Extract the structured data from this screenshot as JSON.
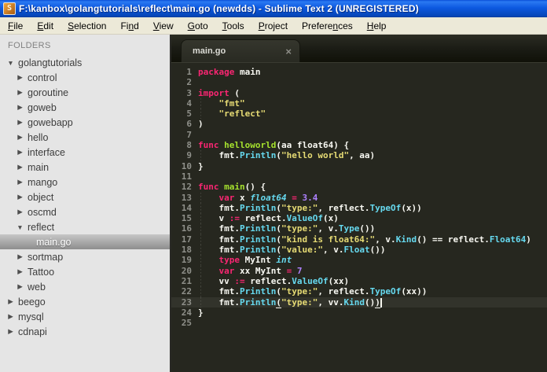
{
  "window": {
    "title": "F:\\kanbox\\golangtutorials\\reflect\\main.go (newdds) - Sublime Text 2 (UNREGISTERED)",
    "icon_letter": "S"
  },
  "menu": {
    "items": [
      {
        "label": "File",
        "u": 0
      },
      {
        "label": "Edit",
        "u": 0
      },
      {
        "label": "Selection",
        "u": 0
      },
      {
        "label": "Find",
        "u": 2
      },
      {
        "label": "View",
        "u": 0
      },
      {
        "label": "Goto",
        "u": 0
      },
      {
        "label": "Tools",
        "u": 0
      },
      {
        "label": "Project",
        "u": 0
      },
      {
        "label": "Preferences",
        "u": 7
      },
      {
        "label": "Help",
        "u": 0
      }
    ]
  },
  "sidebar": {
    "header": "FOLDERS",
    "icons": {
      "open": "▼",
      "closed": "▶"
    },
    "items": [
      {
        "label": "golangtutorials",
        "depth": 0,
        "state": "open"
      },
      {
        "label": "control",
        "depth": 1,
        "state": "closed"
      },
      {
        "label": "goroutine",
        "depth": 1,
        "state": "closed"
      },
      {
        "label": "goweb",
        "depth": 1,
        "state": "closed"
      },
      {
        "label": "gowebapp",
        "depth": 1,
        "state": "closed"
      },
      {
        "label": "hello",
        "depth": 1,
        "state": "closed"
      },
      {
        "label": "interface",
        "depth": 1,
        "state": "closed"
      },
      {
        "label": "main",
        "depth": 1,
        "state": "closed"
      },
      {
        "label": "mango",
        "depth": 1,
        "state": "closed"
      },
      {
        "label": "object",
        "depth": 1,
        "state": "closed"
      },
      {
        "label": "oscmd",
        "depth": 1,
        "state": "closed"
      },
      {
        "label": "reflect",
        "depth": 1,
        "state": "open"
      },
      {
        "label": "main.go",
        "depth": 2,
        "state": "file",
        "selected": true
      },
      {
        "label": "sortmap",
        "depth": 1,
        "state": "closed"
      },
      {
        "label": "Tattoo",
        "depth": 1,
        "state": "closed"
      },
      {
        "label": "web",
        "depth": 1,
        "state": "closed"
      },
      {
        "label": "beego",
        "depth": 0,
        "state": "closed"
      },
      {
        "label": "mysql",
        "depth": 0,
        "state": "closed"
      },
      {
        "label": "cdnapi",
        "depth": 0,
        "state": "closed"
      }
    ]
  },
  "tabbar": {
    "tabs": [
      {
        "label": "main.go",
        "close_glyph": "×",
        "active": true
      }
    ]
  },
  "editor": {
    "language": "Go",
    "current_line": 23,
    "colors": {
      "background": "#26271f",
      "keyword": "#f92672",
      "function": "#a6e22e",
      "string": "#e6db74",
      "type": "#66d9ef",
      "number": "#ae81ff",
      "plain": "#f8f8f2",
      "line_number": "#8f908a",
      "current_line_bg": "#32332b"
    },
    "lines": [
      {
        "num": 1,
        "tokens": [
          [
            "kw",
            "package"
          ],
          [
            "pl",
            " main"
          ]
        ]
      },
      {
        "num": 2,
        "tokens": []
      },
      {
        "num": 3,
        "tokens": [
          [
            "kw",
            "import"
          ],
          [
            "pl",
            " ("
          ]
        ]
      },
      {
        "num": 4,
        "tokens": [
          [
            "pl",
            "    "
          ],
          [
            "str",
            "\"fmt\""
          ]
        ]
      },
      {
        "num": 5,
        "tokens": [
          [
            "pl",
            "    "
          ],
          [
            "str",
            "\"reflect\""
          ]
        ]
      },
      {
        "num": 6,
        "tokens": [
          [
            "pl",
            ")"
          ]
        ]
      },
      {
        "num": 7,
        "tokens": []
      },
      {
        "num": 8,
        "tokens": [
          [
            "kw",
            "func"
          ],
          [
            "pl",
            " "
          ],
          [
            "fn",
            "helloworld"
          ],
          [
            "pl",
            "(aa float64) {"
          ]
        ]
      },
      {
        "num": 9,
        "tokens": [
          [
            "pl",
            "    fmt."
          ],
          [
            "typc",
            "Println"
          ],
          [
            "pl",
            "("
          ],
          [
            "str",
            "\"hello world\""
          ],
          [
            "pl",
            ", aa)"
          ]
        ]
      },
      {
        "num": 10,
        "tokens": [
          [
            "pl",
            "}"
          ]
        ]
      },
      {
        "num": 11,
        "tokens": []
      },
      {
        "num": 12,
        "tokens": [
          [
            "kw",
            "func"
          ],
          [
            "pl",
            " "
          ],
          [
            "fn",
            "main"
          ],
          [
            "pl",
            "() {"
          ]
        ]
      },
      {
        "num": 13,
        "tokens": [
          [
            "pl",
            "    "
          ],
          [
            "kw",
            "var"
          ],
          [
            "pl",
            " x "
          ],
          [
            "typ",
            "float64"
          ],
          [
            "pl",
            " "
          ],
          [
            "op",
            "="
          ],
          [
            "pl",
            " "
          ],
          [
            "num",
            "3.4"
          ]
        ]
      },
      {
        "num": 14,
        "tokens": [
          [
            "pl",
            "    fmt."
          ],
          [
            "typc",
            "Println"
          ],
          [
            "pl",
            "("
          ],
          [
            "str",
            "\"type:\""
          ],
          [
            "pl",
            ", reflect."
          ],
          [
            "typc",
            "TypeOf"
          ],
          [
            "pl",
            "(x))"
          ]
        ]
      },
      {
        "num": 15,
        "tokens": [
          [
            "pl",
            "    v "
          ],
          [
            "op",
            ":="
          ],
          [
            "pl",
            " reflect."
          ],
          [
            "typc",
            "ValueOf"
          ],
          [
            "pl",
            "(x)"
          ]
        ]
      },
      {
        "num": 16,
        "tokens": [
          [
            "pl",
            "    fmt."
          ],
          [
            "typc",
            "Println"
          ],
          [
            "pl",
            "("
          ],
          [
            "str",
            "\"type:\""
          ],
          [
            "pl",
            ", v."
          ],
          [
            "typc",
            "Type"
          ],
          [
            "pl",
            "())"
          ]
        ]
      },
      {
        "num": 17,
        "tokens": [
          [
            "pl",
            "    fmt."
          ],
          [
            "typc",
            "Println"
          ],
          [
            "pl",
            "("
          ],
          [
            "str",
            "\"kind is float64:\""
          ],
          [
            "pl",
            ", v."
          ],
          [
            "typc",
            "Kind"
          ],
          [
            "pl",
            "() == reflect."
          ],
          [
            "typc",
            "Float64"
          ],
          [
            "pl",
            ")"
          ]
        ]
      },
      {
        "num": 18,
        "tokens": [
          [
            "pl",
            "    fmt."
          ],
          [
            "typc",
            "Println"
          ],
          [
            "pl",
            "("
          ],
          [
            "str",
            "\"value:\""
          ],
          [
            "pl",
            ", v."
          ],
          [
            "typc",
            "Float"
          ],
          [
            "pl",
            "())"
          ]
        ]
      },
      {
        "num": 19,
        "tokens": [
          [
            "pl",
            "    "
          ],
          [
            "kw",
            "type"
          ],
          [
            "pl",
            " MyInt "
          ],
          [
            "typ",
            "int"
          ]
        ]
      },
      {
        "num": 20,
        "tokens": [
          [
            "pl",
            "    "
          ],
          [
            "kw",
            "var"
          ],
          [
            "pl",
            " xx MyInt "
          ],
          [
            "op",
            "="
          ],
          [
            "pl",
            " "
          ],
          [
            "num",
            "7"
          ]
        ]
      },
      {
        "num": 21,
        "tokens": [
          [
            "pl",
            "    vv "
          ],
          [
            "op",
            ":="
          ],
          [
            "pl",
            " reflect."
          ],
          [
            "typc",
            "ValueOf"
          ],
          [
            "pl",
            "(xx)"
          ]
        ]
      },
      {
        "num": 22,
        "tokens": [
          [
            "pl",
            "    fmt."
          ],
          [
            "typc",
            "Println"
          ],
          [
            "pl",
            "("
          ],
          [
            "str",
            "\"type:\""
          ],
          [
            "pl",
            ", reflect."
          ],
          [
            "typc",
            "TypeOf"
          ],
          [
            "pl",
            "(xx))"
          ]
        ]
      },
      {
        "num": 23,
        "tokens": [
          [
            "pl",
            "    fmt."
          ],
          [
            "typc",
            "Println"
          ],
          [
            "pl ul",
            "("
          ],
          [
            "str",
            "\"type:\""
          ],
          [
            "pl",
            ", vv."
          ],
          [
            "typc",
            "Kind"
          ],
          [
            "pl",
            "()"
          ],
          [
            "pl ul",
            ")"
          ],
          [
            "caret",
            ""
          ]
        ]
      },
      {
        "num": 24,
        "tokens": [
          [
            "pl",
            "}"
          ]
        ]
      },
      {
        "num": 25,
        "tokens": []
      }
    ]
  }
}
